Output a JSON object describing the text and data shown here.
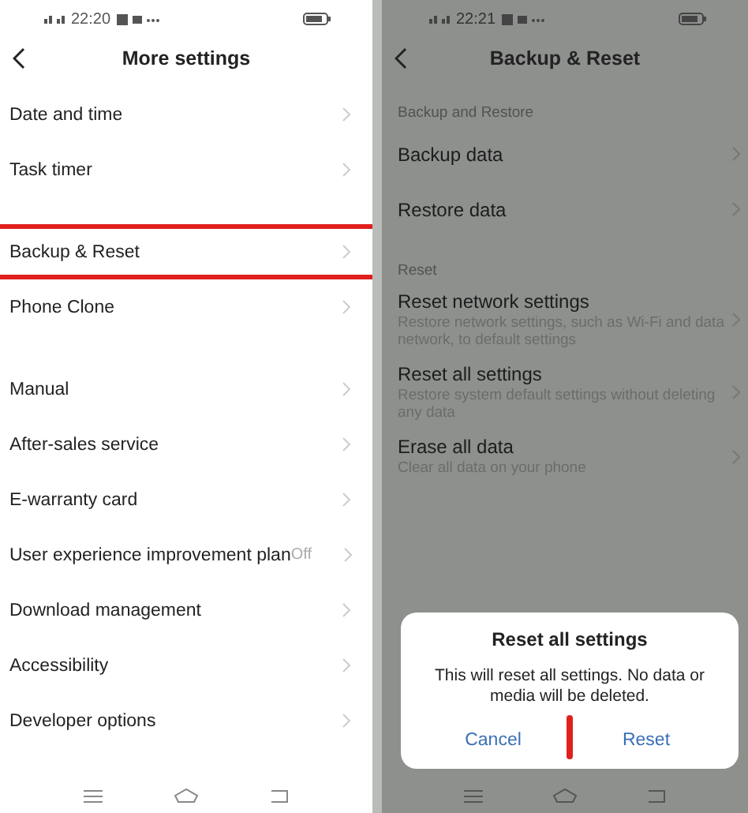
{
  "left_screen": {
    "status_time": "22:20",
    "title": "More settings",
    "groups": [
      {
        "items": [
          {
            "label": "Date and time",
            "highlighted": false
          },
          {
            "label": "Task timer",
            "highlighted": false
          }
        ]
      },
      {
        "items": [
          {
            "label": "Backup & Reset",
            "highlighted": true
          },
          {
            "label": "Phone Clone",
            "highlighted": false
          }
        ]
      },
      {
        "items": [
          {
            "label": "Manual",
            "highlighted": false
          },
          {
            "label": "After-sales service",
            "highlighted": false
          },
          {
            "label": "E-warranty card",
            "highlighted": false
          },
          {
            "label": "User experience improvement plan",
            "value": "Off",
            "highlighted": false
          },
          {
            "label": "Download management",
            "highlighted": false
          },
          {
            "label": "Accessibility",
            "highlighted": false
          },
          {
            "label": "Developer options",
            "highlighted": false
          }
        ]
      }
    ]
  },
  "right_screen": {
    "status_time": "22:21",
    "title": "Backup & Reset",
    "sections": [
      {
        "header": "Backup and Restore",
        "items": [
          {
            "label": "Backup data"
          },
          {
            "label": "Restore data"
          }
        ]
      },
      {
        "header": "Reset",
        "items": [
          {
            "label": "Reset network settings",
            "subtitle": "Restore network settings, such as Wi-Fi and data network, to default settings"
          },
          {
            "label": "Reset all settings",
            "subtitle": "Restore system default settings without deleting any data"
          },
          {
            "label": "Erase all data",
            "subtitle": "Clear all data on your phone"
          }
        ]
      }
    ],
    "dialog": {
      "title": "Reset all settings",
      "message": "This will reset all settings. No data or media will be deleted.",
      "highlight_mark": true,
      "buttons": [
        {
          "label": "Cancel"
        },
        {
          "label": "Reset"
        }
      ]
    }
  }
}
